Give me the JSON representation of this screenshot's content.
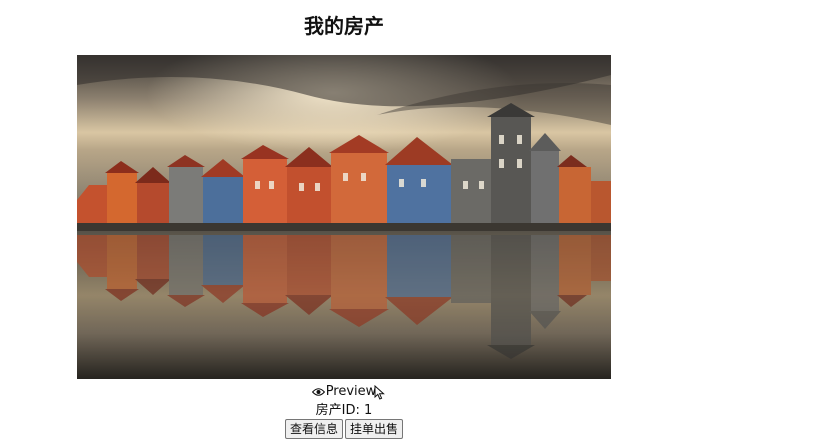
{
  "page": {
    "title": "我的房产"
  },
  "property": {
    "photo_alt": "House photo",
    "preview_label": "Preview",
    "id_label": "房产ID: 1"
  },
  "actions": {
    "view_info_label": "查看信息",
    "list_for_sale_label": "挂单出售"
  }
}
